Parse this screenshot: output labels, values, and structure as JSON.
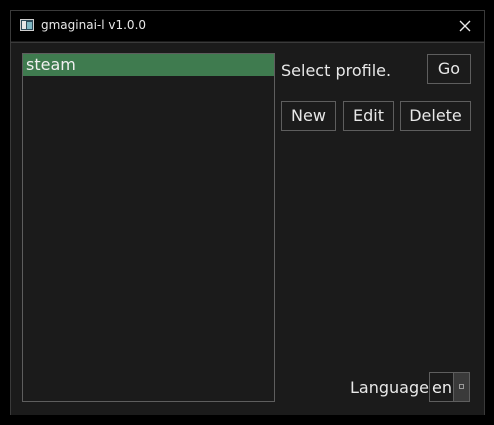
{
  "window": {
    "title": "gmaginai-l v1.0.0",
    "icon": "app-window-icon",
    "close_icon": "close-icon"
  },
  "profiles": {
    "items": [
      {
        "label": "steam",
        "selected": true
      }
    ]
  },
  "prompt": "Select profile.",
  "buttons": {
    "go": "Go",
    "new": "New",
    "edit": "Edit",
    "delete": "Delete"
  },
  "language": {
    "label": "Language",
    "value": "en"
  },
  "colors": {
    "background": "#1b1b1b",
    "titlebar": "#000000",
    "selection": "#3f7b4f",
    "border": "#5e5e5e",
    "text": "#e8e8e8"
  }
}
